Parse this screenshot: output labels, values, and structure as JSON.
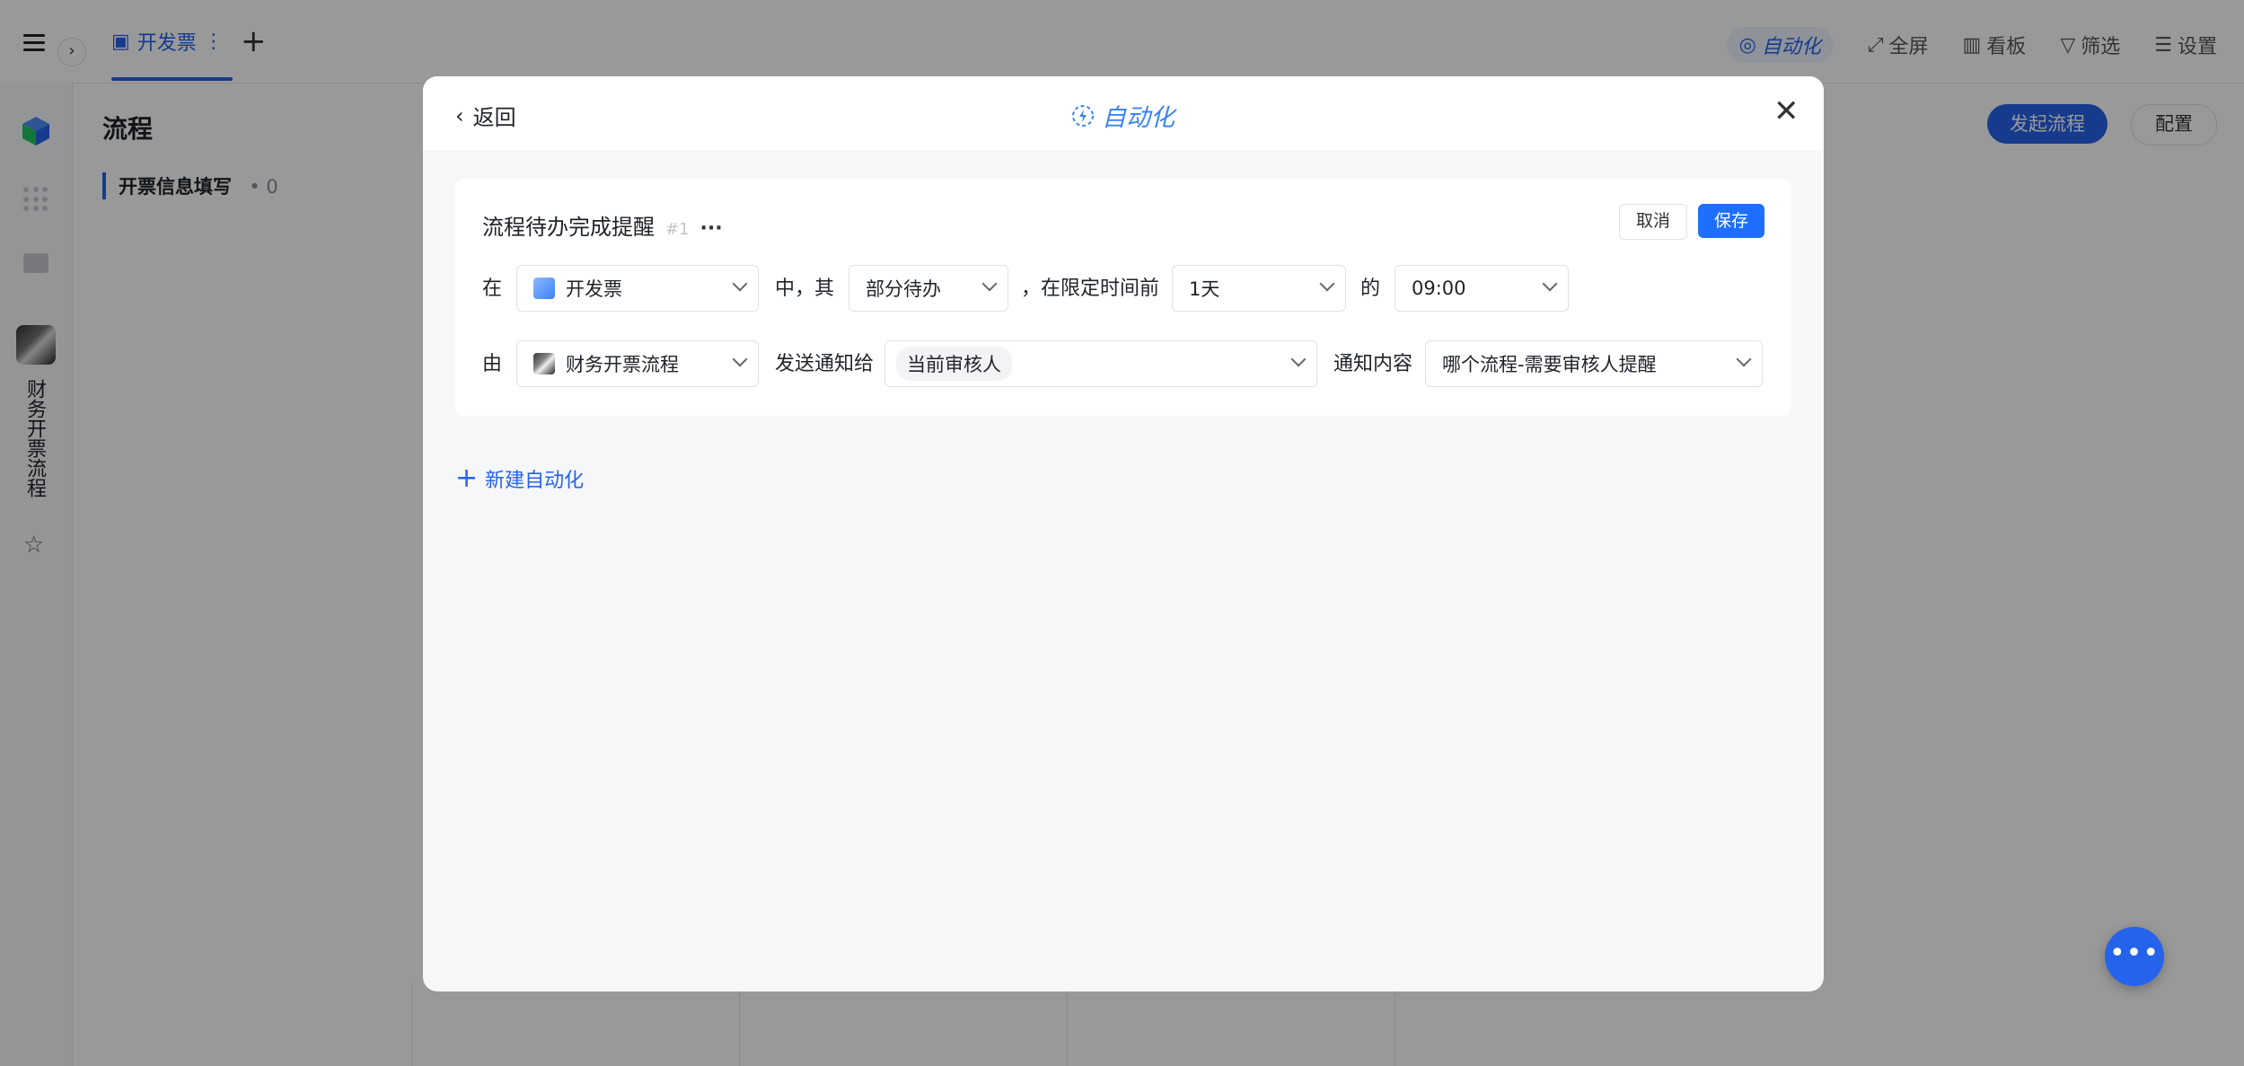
{
  "topbar": {
    "tab_label": "开发票",
    "actions": [
      "自动化",
      "全屏",
      "看板",
      "筛选",
      "设置"
    ]
  },
  "sidebar": {
    "app_name": "财务开票流程"
  },
  "main": {
    "title": "流程",
    "section": {
      "label": "开票信息填写",
      "count": "0"
    },
    "start_button": "发起流程",
    "config_button": "配置"
  },
  "modal": {
    "back_label": "返回",
    "title": "自动化",
    "rule": {
      "name": "流程待办完成提醒",
      "index": "#1",
      "more": "···",
      "cancel_label": "取消",
      "save_label": "保存",
      "row1": {
        "label_in": "在",
        "form_value": "开发票",
        "label_mid": "中，其",
        "status_value": "部分待办",
        "label_before": "，在限定时间前",
        "time_value": "1天",
        "label_of": "的",
        "clock_value": "09:00"
      },
      "row2": {
        "label_by": "由",
        "process_value": "财务开票流程",
        "label_send": "发送通知给",
        "recipient_tag": "当前审核人",
        "label_content": "通知内容",
        "content_value": "哪个流程-需要审核人提醒"
      }
    },
    "new_automation_label": "新建自动化"
  },
  "colors": {
    "accent": "#2563eb",
    "save": "#1e6fff",
    "mask": "rgba(0,0,0,0.4)"
  }
}
